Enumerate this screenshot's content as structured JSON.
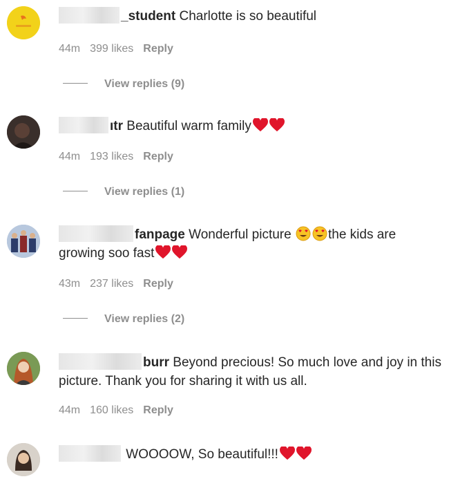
{
  "comments": [
    {
      "username": "_student",
      "text": "Charlotte is so beautiful",
      "time": "44m",
      "likes": "399 likes",
      "reply": "Reply",
      "view_replies": "View replies (9)"
    },
    {
      "username": "ıtr",
      "text": "Beautiful warm family",
      "time": "44m",
      "likes": "193 likes",
      "reply": "Reply",
      "view_replies": "View replies (1)"
    },
    {
      "username": "fanpage",
      "text_part1": "Wonderful picture",
      "text_part2": "the kids are growing soo fast",
      "time": "43m",
      "likes": "237 likes",
      "reply": "Reply",
      "view_replies": "View replies (2)"
    },
    {
      "username": "burr",
      "text": "Beyond precious! So much love and joy in this picture. Thank you for sharing it with us all.",
      "time": "44m",
      "likes": "160 likes",
      "reply": "Reply"
    },
    {
      "username": "",
      "text": "WOOOOW, So beautiful!!!"
    }
  ],
  "icons": {
    "heart": "red-heart-emoji",
    "heart_eyes": "heart-eyes-emoji"
  },
  "colors": {
    "heart": "#e0152b",
    "meta": "#8e8e8e",
    "text": "#262626"
  }
}
